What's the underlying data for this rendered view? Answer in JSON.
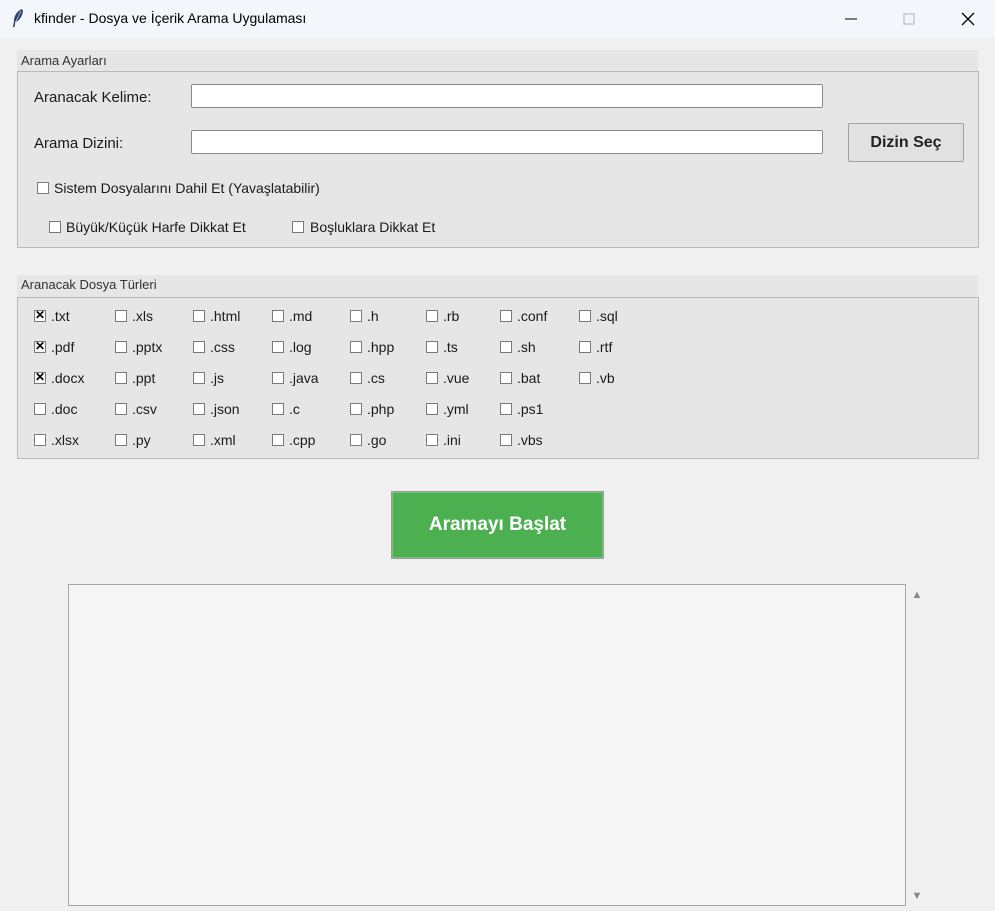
{
  "window": {
    "title": "kfinder - Dosya ve İçerik Arama Uygulaması",
    "minimize_icon": "minimize-icon",
    "maximize_icon": "maximize-icon",
    "close_icon": "close-icon"
  },
  "search_settings": {
    "group_label": "Arama Ayarları",
    "keyword_label": "Aranacak Kelime:",
    "keyword_value": "",
    "directory_label": "Arama Dizini:",
    "directory_value": "",
    "choose_dir_button": "Dizin Seç",
    "include_system_files": "Sistem Dosyalarını Dahil Et (Yavaşlatabilir)",
    "case_sensitive": "Büyük/Küçük Harfe Dikkat Et",
    "whitespace_sensitive": "Boşluklara Dikkat Et"
  },
  "file_types": {
    "group_label": "Aranacak Dosya Türleri",
    "columns": [
      [
        {
          "label": ".txt",
          "checked": true
        },
        {
          "label": ".pdf",
          "checked": true
        },
        {
          "label": ".docx",
          "checked": true
        },
        {
          "label": ".doc",
          "checked": false
        },
        {
          "label": ".xlsx",
          "checked": false
        }
      ],
      [
        {
          "label": ".xls",
          "checked": false
        },
        {
          "label": ".pptx",
          "checked": false
        },
        {
          "label": ".ppt",
          "checked": false
        },
        {
          "label": ".csv",
          "checked": false
        },
        {
          "label": ".py",
          "checked": false
        }
      ],
      [
        {
          "label": ".html",
          "checked": false
        },
        {
          "label": ".css",
          "checked": false
        },
        {
          "label": ".js",
          "checked": false
        },
        {
          "label": ".json",
          "checked": false
        },
        {
          "label": ".xml",
          "checked": false
        }
      ],
      [
        {
          "label": ".md",
          "checked": false
        },
        {
          "label": ".log",
          "checked": false
        },
        {
          "label": ".java",
          "checked": false
        },
        {
          "label": ".c",
          "checked": false
        },
        {
          "label": ".cpp",
          "checked": false
        }
      ],
      [
        {
          "label": ".h",
          "checked": false
        },
        {
          "label": ".hpp",
          "checked": false
        },
        {
          "label": ".cs",
          "checked": false
        },
        {
          "label": ".php",
          "checked": false
        },
        {
          "label": ".go",
          "checked": false
        }
      ],
      [
        {
          "label": ".rb",
          "checked": false
        },
        {
          "label": ".ts",
          "checked": false
        },
        {
          "label": ".vue",
          "checked": false
        },
        {
          "label": ".yml",
          "checked": false
        },
        {
          "label": ".ini",
          "checked": false
        }
      ],
      [
        {
          "label": ".conf",
          "checked": false
        },
        {
          "label": ".sh",
          "checked": false
        },
        {
          "label": ".bat",
          "checked": false
        },
        {
          "label": ".ps1",
          "checked": false
        },
        {
          "label": ".vbs",
          "checked": false
        }
      ],
      [
        {
          "label": ".sql",
          "checked": false
        },
        {
          "label": ".rtf",
          "checked": false
        },
        {
          "label": ".vb",
          "checked": false
        }
      ]
    ]
  },
  "start_button": "Aramayı Başlat",
  "results_text": ""
}
